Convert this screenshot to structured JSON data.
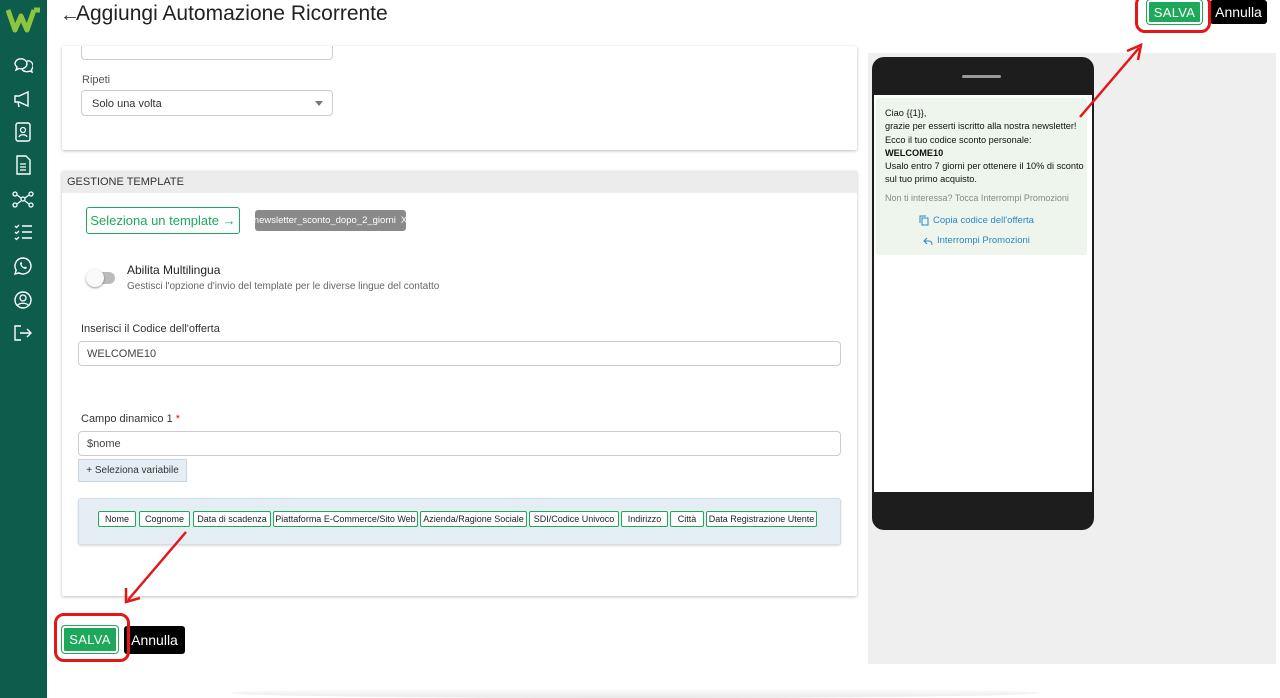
{
  "header": {
    "title": "Aggiungi Automazione Ricorrente",
    "back_glyph": "←",
    "save_label": "SALVA",
    "cancel_label": "Annulla"
  },
  "sidebar": {
    "logo": "W",
    "icons": [
      "chat-icon",
      "megaphone-icon",
      "contacts-icon",
      "document-icon",
      "flow-icon",
      "checklist-icon",
      "whatsapp-icon",
      "user-icon",
      "logout-icon"
    ]
  },
  "schedule": {
    "repeat_label": "Ripeti",
    "repeat_value": "Solo una volta"
  },
  "template": {
    "section_title": "GESTIONE TEMPLATE",
    "select_button": "Seleziona un template →",
    "selected_chip": "newsletter_sconto_dopo_2_giorni",
    "chip_remove": "X",
    "multilang_title": "Abilita Multilingua",
    "multilang_desc": "Gestisci l'opzione d'invio del template per le diverse lingue del contatto",
    "offer_label": "Inserisci il Codice dell'offerta",
    "offer_value": "WELCOME10",
    "dynamic_label": "Campo dinamico 1",
    "dynamic_required": "*",
    "dynamic_value": "$nome",
    "select_variable": "+ Seleziona variabile",
    "variables": [
      "Nome",
      "Cognome",
      "Data di scadenza",
      "Piattaforma E-Commerce/Sito Web",
      "Azienda/Ragione Sociale",
      "SDI/Codice Univoco",
      "Indirizzo",
      "Città",
      "Data Registrazione Utente"
    ]
  },
  "footer": {
    "save_label": "SALVA",
    "cancel_label": "Annulla"
  },
  "preview": {
    "lines": [
      "Ciao {{1}},",
      "grazie per esserti iscritto alla nostra newsletter!",
      "Ecco il tuo codice sconto personale:"
    ],
    "code": "WELCOME10",
    "lines2": [
      "Usalo entro 7 giorni per ottenere il 10% di sconto",
      "sul tuo primo acquisto."
    ],
    "note": "Non ti interessa? Tocca Interrompi Promozioni",
    "action_copy": "Copia codice dell'offerta",
    "action_stop": "Interrompi Promozioni"
  },
  "colors": {
    "sidebar": "#0e5c4c",
    "accent": "#1ea85a",
    "highlight": "#e51616",
    "link": "#2b86c5"
  }
}
